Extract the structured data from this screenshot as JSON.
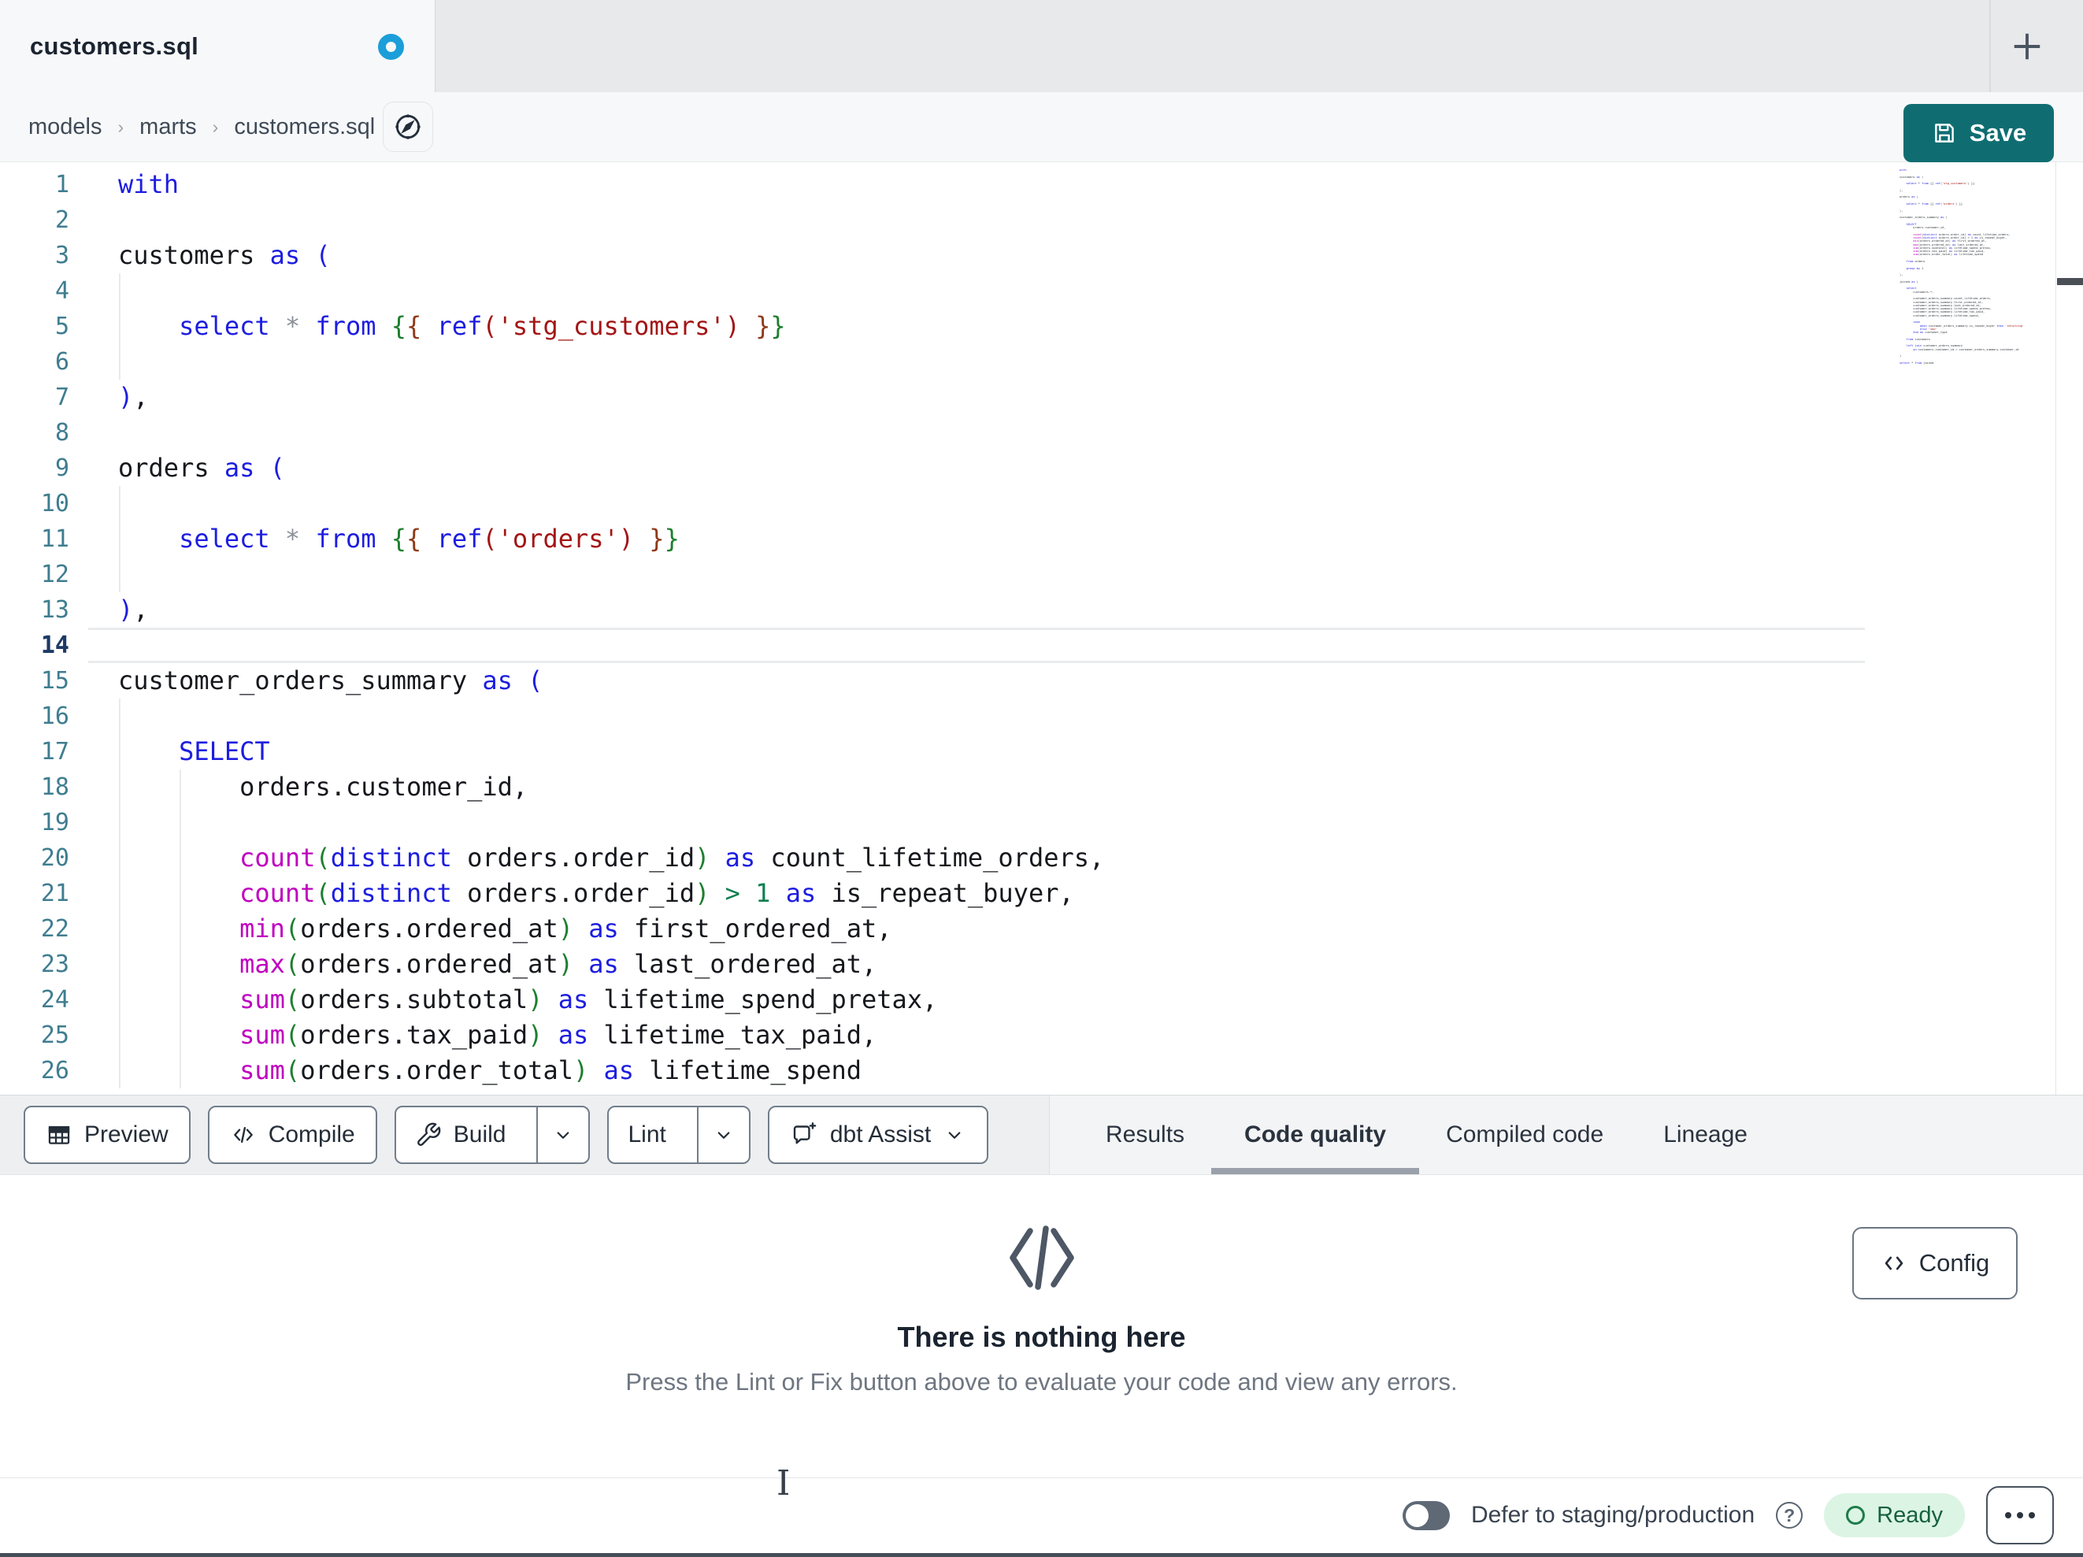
{
  "tab_bar": {
    "title": "customers.sql",
    "unsaved": true
  },
  "breadcrumb": {
    "items": [
      "models",
      "marts",
      "customers.sql"
    ]
  },
  "save_button": {
    "label": "Save"
  },
  "editor": {
    "active_line": 14,
    "token_colors": {
      "t": "#16181d",
      "k": "#1d1de0",
      "p": "#1d1de0",
      "f": "#bf00bf",
      "s": "#a31515",
      "g": "#1e7f2f",
      "b": "#8f3a1a",
      "o": "#8a9099",
      "n": "#0f7f4f"
    },
    "lines": [
      {
        "n": 1,
        "tokens": [
          [
            "k",
            "with"
          ]
        ]
      },
      {
        "n": 2,
        "tokens": []
      },
      {
        "n": 3,
        "tokens": [
          [
            "t",
            "customers "
          ],
          [
            "k",
            "as"
          ],
          [
            "t",
            " "
          ],
          [
            "p",
            "("
          ]
        ]
      },
      {
        "n": 4,
        "tokens": []
      },
      {
        "n": 5,
        "tokens": [
          [
            "t",
            "    "
          ],
          [
            "k",
            "select"
          ],
          [
            "t",
            " "
          ],
          [
            "o",
            "*"
          ],
          [
            "t",
            " "
          ],
          [
            "k",
            "from"
          ],
          [
            "t",
            " "
          ],
          [
            "g",
            "{"
          ],
          [
            "b",
            "{"
          ],
          [
            "t",
            " "
          ],
          [
            "k",
            "ref"
          ],
          [
            "s",
            "('stg_customers')"
          ],
          [
            "t",
            " "
          ],
          [
            "b",
            "}"
          ],
          [
            "g",
            "}"
          ]
        ]
      },
      {
        "n": 6,
        "tokens": []
      },
      {
        "n": 7,
        "tokens": [
          [
            "p",
            ")"
          ],
          [
            "t",
            ","
          ]
        ]
      },
      {
        "n": 8,
        "tokens": []
      },
      {
        "n": 9,
        "tokens": [
          [
            "t",
            "orders "
          ],
          [
            "k",
            "as"
          ],
          [
            "t",
            " "
          ],
          [
            "p",
            "("
          ]
        ]
      },
      {
        "n": 10,
        "tokens": []
      },
      {
        "n": 11,
        "tokens": [
          [
            "t",
            "    "
          ],
          [
            "k",
            "select"
          ],
          [
            "t",
            " "
          ],
          [
            "o",
            "*"
          ],
          [
            "t",
            " "
          ],
          [
            "k",
            "from"
          ],
          [
            "t",
            " "
          ],
          [
            "g",
            "{"
          ],
          [
            "b",
            "{"
          ],
          [
            "t",
            " "
          ],
          [
            "k",
            "ref"
          ],
          [
            "s",
            "('orders')"
          ],
          [
            "t",
            " "
          ],
          [
            "b",
            "}"
          ],
          [
            "g",
            "}"
          ]
        ]
      },
      {
        "n": 12,
        "tokens": []
      },
      {
        "n": 13,
        "tokens": [
          [
            "p",
            ")"
          ],
          [
            "t",
            ","
          ]
        ]
      },
      {
        "n": 14,
        "tokens": []
      },
      {
        "n": 15,
        "tokens": [
          [
            "t",
            "customer_orders_summary "
          ],
          [
            "k",
            "as"
          ],
          [
            "t",
            " "
          ],
          [
            "p",
            "("
          ]
        ]
      },
      {
        "n": 16,
        "tokens": []
      },
      {
        "n": 17,
        "tokens": [
          [
            "t",
            "    "
          ],
          [
            "k",
            "SELECT"
          ]
        ]
      },
      {
        "n": 18,
        "tokens": [
          [
            "t",
            "        orders.customer_id,"
          ]
        ]
      },
      {
        "n": 19,
        "tokens": []
      },
      {
        "n": 20,
        "tokens": [
          [
            "t",
            "        "
          ],
          [
            "f",
            "count"
          ],
          [
            "g",
            "("
          ],
          [
            "k",
            "distinct"
          ],
          [
            "t",
            " orders.order_id"
          ],
          [
            "g",
            ")"
          ],
          [
            "t",
            " "
          ],
          [
            "k",
            "as"
          ],
          [
            "t",
            " count_lifetime_orders,"
          ]
        ]
      },
      {
        "n": 21,
        "tokens": [
          [
            "t",
            "        "
          ],
          [
            "f",
            "count"
          ],
          [
            "g",
            "("
          ],
          [
            "k",
            "distinct"
          ],
          [
            "t",
            " orders.order_id"
          ],
          [
            "g",
            ")"
          ],
          [
            "t",
            " "
          ],
          [
            "n",
            ">"
          ],
          [
            "t",
            " "
          ],
          [
            "n",
            "1"
          ],
          [
            "t",
            " "
          ],
          [
            "k",
            "as"
          ],
          [
            "t",
            " is_repeat_buyer,"
          ]
        ]
      },
      {
        "n": 22,
        "tokens": [
          [
            "t",
            "        "
          ],
          [
            "f",
            "min"
          ],
          [
            "g",
            "("
          ],
          [
            "t",
            "orders.ordered_at"
          ],
          [
            "g",
            ")"
          ],
          [
            "t",
            " "
          ],
          [
            "k",
            "as"
          ],
          [
            "t",
            " first_ordered_at,"
          ]
        ]
      },
      {
        "n": 23,
        "tokens": [
          [
            "t",
            "        "
          ],
          [
            "f",
            "max"
          ],
          [
            "g",
            "("
          ],
          [
            "t",
            "orders.ordered_at"
          ],
          [
            "g",
            ")"
          ],
          [
            "t",
            " "
          ],
          [
            "k",
            "as"
          ],
          [
            "t",
            " last_ordered_at,"
          ]
        ]
      },
      {
        "n": 24,
        "tokens": [
          [
            "t",
            "        "
          ],
          [
            "f",
            "sum"
          ],
          [
            "g",
            "("
          ],
          [
            "t",
            "orders.subtotal"
          ],
          [
            "g",
            ")"
          ],
          [
            "t",
            " "
          ],
          [
            "k",
            "as"
          ],
          [
            "t",
            " lifetime_spend_pretax,"
          ]
        ]
      },
      {
        "n": 25,
        "tokens": [
          [
            "t",
            "        "
          ],
          [
            "f",
            "sum"
          ],
          [
            "g",
            "("
          ],
          [
            "t",
            "orders.tax_paid"
          ],
          [
            "g",
            ")"
          ],
          [
            "t",
            " "
          ],
          [
            "k",
            "as"
          ],
          [
            "t",
            " lifetime_tax_paid,"
          ]
        ]
      },
      {
        "n": 26,
        "tokens": [
          [
            "t",
            "        "
          ],
          [
            "f",
            "sum"
          ],
          [
            "g",
            "("
          ],
          [
            "t",
            "orders.order_total"
          ],
          [
            "g",
            ")"
          ],
          [
            "t",
            " "
          ],
          [
            "k",
            "as"
          ],
          [
            "t",
            " lifetime_spend"
          ]
        ]
      }
    ],
    "minimap_lines": [
      "with",
      "",
      "customers as (",
      "",
      "    select * from {{ ref('stg_customers') }}",
      "",
      "),",
      "",
      "orders as (",
      "",
      "    select * from {{ ref('orders') }}",
      "",
      "),",
      "",
      "customer_orders_summary as (",
      "",
      "    SELECT",
      "        orders.customer_id,",
      "",
      "        count(distinct orders.order_id) as count_lifetime_orders,",
      "        count(distinct orders.order_id) > 1 as is_repeat_buyer,",
      "        min(orders.ordered_at) as first_ordered_at,",
      "        max(orders.ordered_at) as last_ordered_at,",
      "        sum(orders.subtotal) as lifetime_spend_pretax,",
      "        sum(orders.tax_paid) as lifetime_tax_paid,",
      "        sum(orders.order_total) as lifetime_spend",
      "",
      "    from orders",
      "",
      "    group by 1",
      "",
      "),",
      "",
      "joined as (",
      "",
      "    select",
      "        customers.*,",
      "",
      "        customer_orders_summary.count_lifetime_orders,",
      "        customer_orders_summary.first_ordered_at,",
      "        customer_orders_summary.last_ordered_at,",
      "        customer_orders_summary.lifetime_spend_pretax,",
      "        customer_orders_summary.lifetime_tax_paid,",
      "        customer_orders_summary.lifetime_spend,",
      "",
      "        case",
      "            when customer_orders_summary.is_repeat_buyer then 'returning'",
      "            else 'new'",
      "        end as customer_type",
      "",
      "    from customers",
      "",
      "    left join customer_orders_summary",
      "        on customers.customer_id = customer_orders_summary.customer_id",
      "",
      ")",
      "",
      "select * from joined"
    ]
  },
  "toolbar": {
    "buttons": [
      {
        "label": "Preview"
      },
      {
        "label": "Compile"
      },
      {
        "label": "Build",
        "split": true
      },
      {
        "label": "Lint",
        "split": true
      },
      {
        "label": "dbt Assist",
        "caret": true
      }
    ]
  },
  "panel_tabs": {
    "active": "Code quality",
    "items": [
      {
        "label": "Results"
      },
      {
        "label": "Code quality"
      },
      {
        "label": "Compiled code"
      },
      {
        "label": "Lineage"
      }
    ]
  },
  "results_panel": {
    "empty_title": "There is nothing here",
    "empty_subtitle": "Press the Lint or Fix button above to evaluate your code and view any errors.",
    "config_label": "Config"
  },
  "status_bar": {
    "defer_label": "Defer to staging/production",
    "ready_label": "Ready"
  },
  "cursor": {
    "glyph": "I"
  },
  "icons": {
    "new_tab": "plus-icon",
    "file_nav": "compass-icon",
    "save": "floppy-disk-icon",
    "preview": "table-grid-icon",
    "compile": "code-brackets-icon",
    "build": "wrench-icon",
    "caret": "chevron-down-icon",
    "assist": "chat-sparkle-icon",
    "empty_state": "code-slash-icon",
    "config": "code-slash-icon",
    "help": "question-circle-icon",
    "more": "ellipsis-icon",
    "unsaved": "blue-dot-indicator",
    "mouse_cursor": "i-beam-cursor"
  },
  "colors": {
    "accent_teal": "#0f6d72",
    "tab_dot_blue": "#1b9ed9",
    "ready_bg": "#dcf4e4",
    "ready_text": "#17613d",
    "active_tab_underline": "#9aa1aa",
    "line_number": "#3f7d90",
    "active_line_number": "#1c3a63"
  }
}
